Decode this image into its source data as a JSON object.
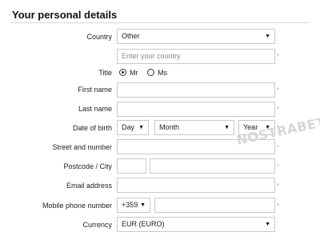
{
  "section": {
    "title": "Your personal details"
  },
  "form": {
    "country": {
      "label": "Country",
      "value": "Other"
    },
    "country_text": {
      "placeholder": "Enter your country"
    },
    "title": {
      "label": "Title",
      "options": [
        "Mr",
        "Ms"
      ],
      "selected": "Mr"
    },
    "first_name": {
      "label": "First name",
      "value": ""
    },
    "last_name": {
      "label": "Last name",
      "value": ""
    },
    "dob": {
      "label": "Date of birth",
      "day": "Day",
      "month": "Month",
      "year": "Year"
    },
    "street": {
      "label": "Street and number",
      "value": ""
    },
    "postcode_city": {
      "label": "Postcode / City",
      "postcode": "",
      "city": ""
    },
    "email": {
      "label": "Email address",
      "value": ""
    },
    "mobile": {
      "label": "Mobile phone number",
      "prefix": "+359",
      "value": ""
    },
    "currency": {
      "label": "Currency",
      "value": "EUR (EURO)"
    },
    "required_marker": "*"
  },
  "watermark": "NOSTRABET"
}
